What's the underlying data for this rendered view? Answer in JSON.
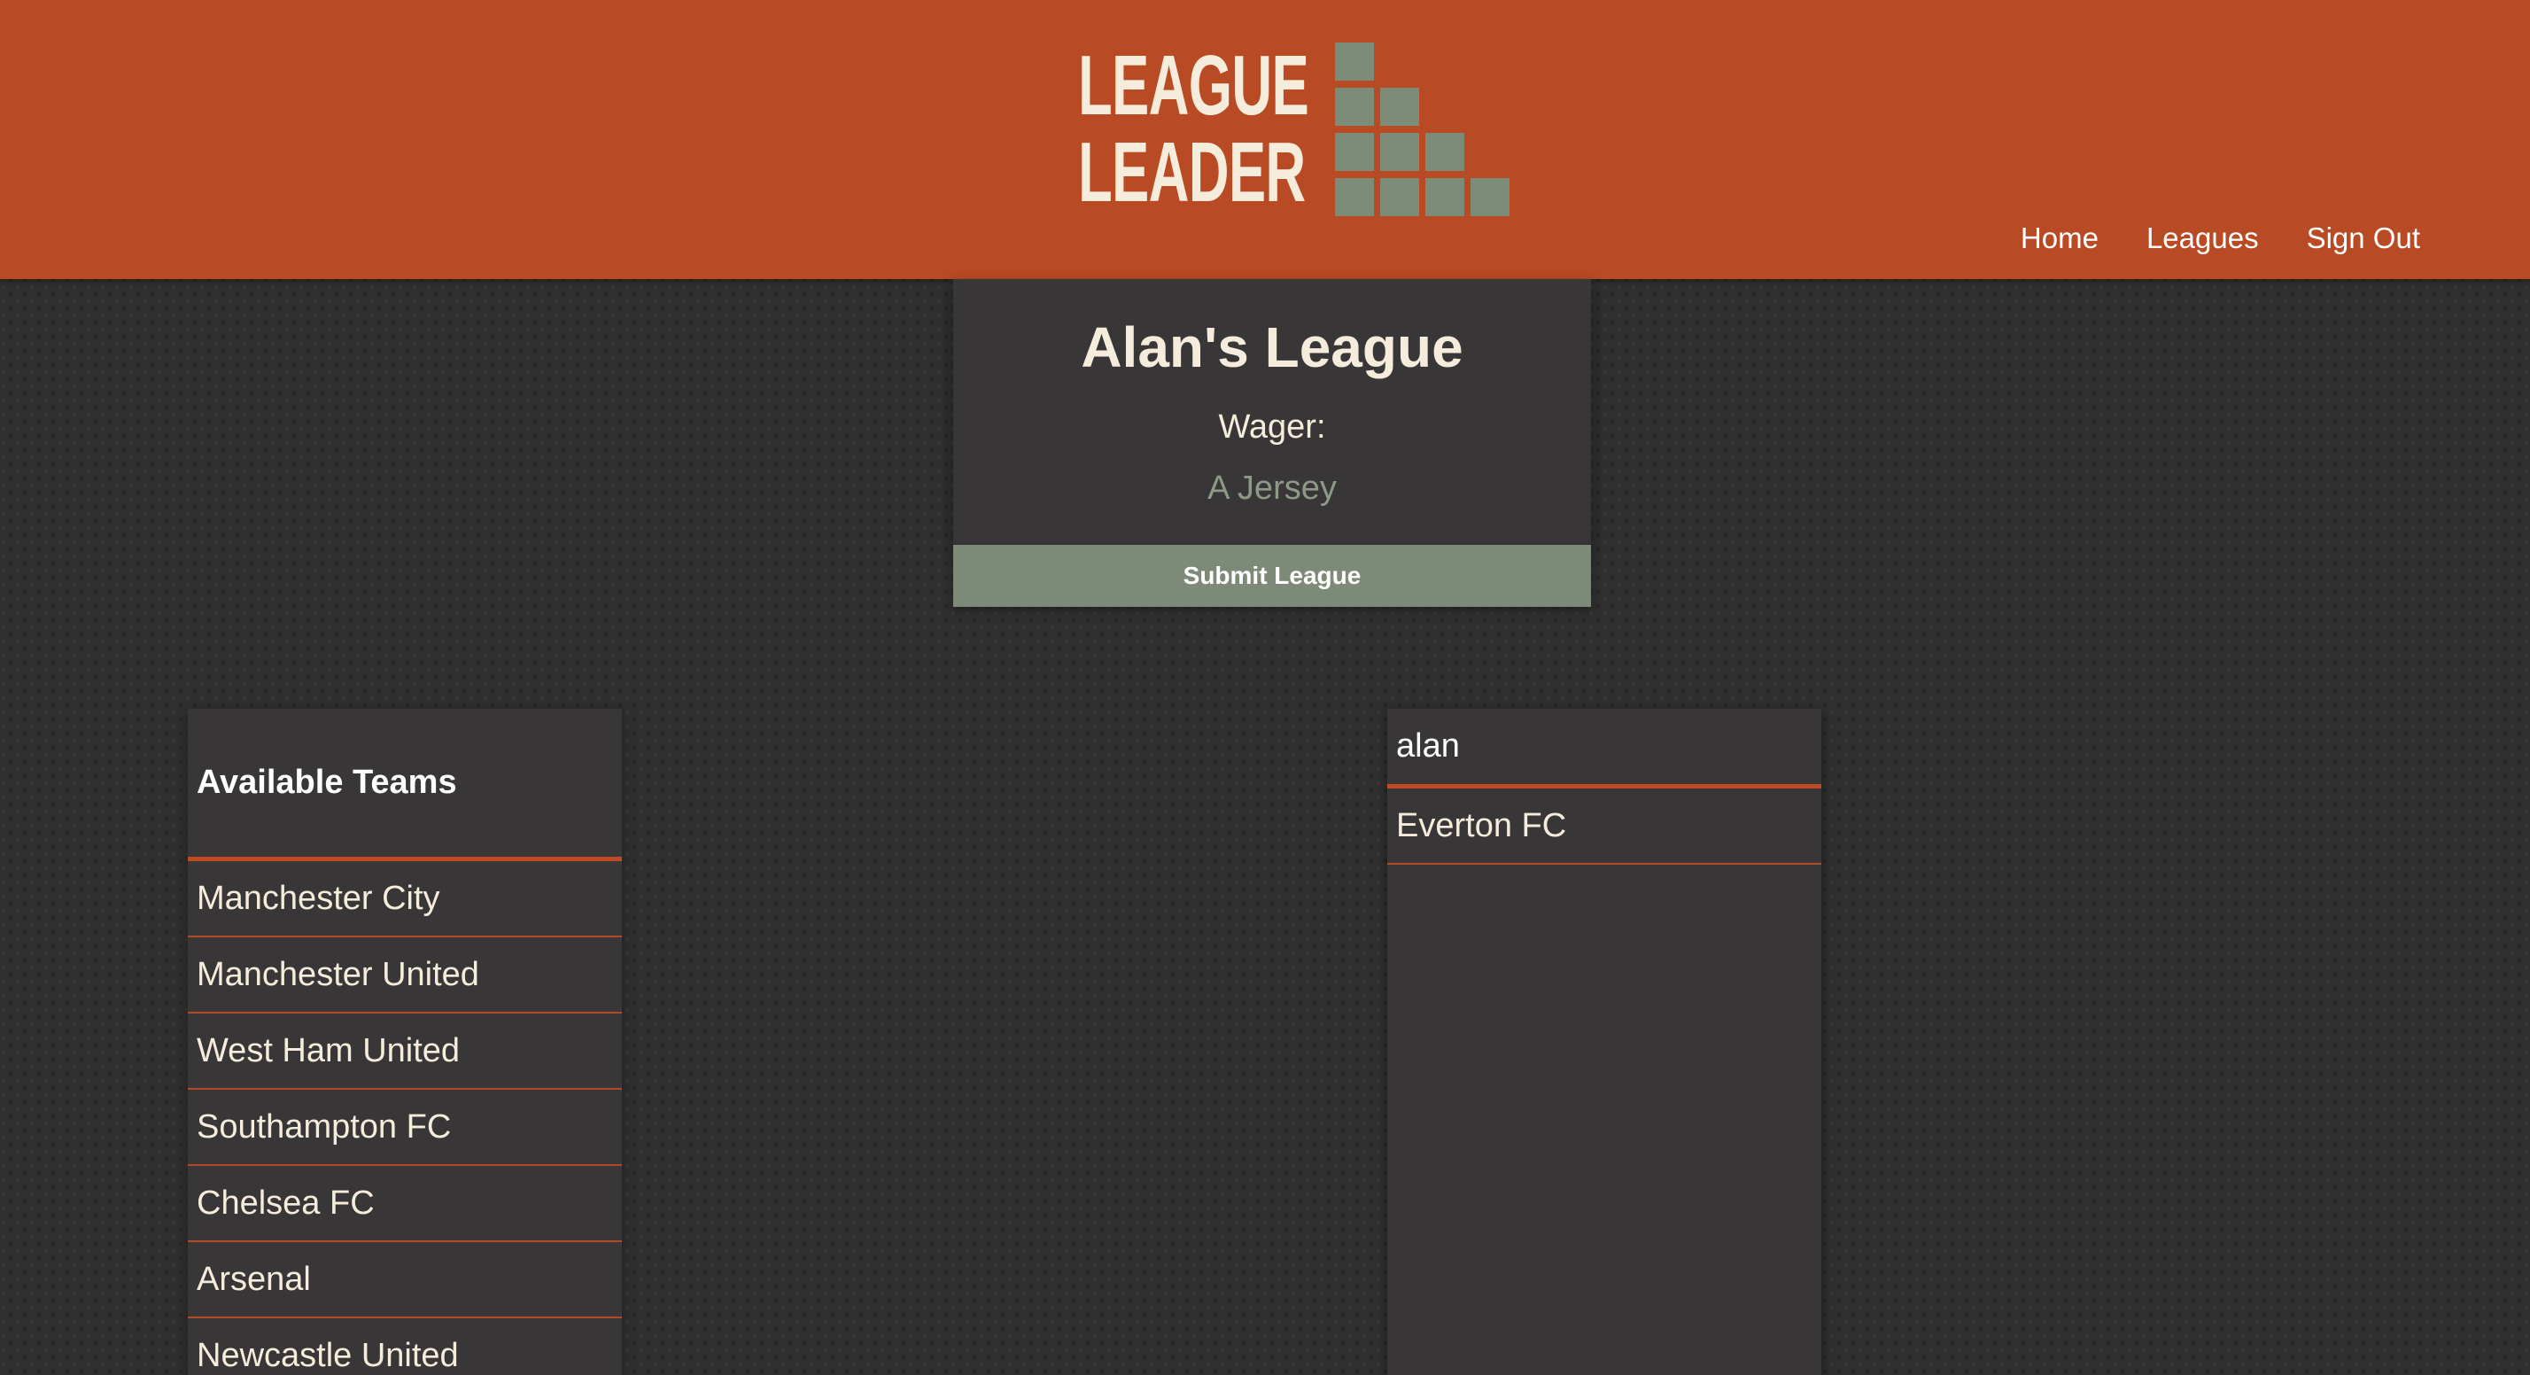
{
  "header": {
    "logo": {
      "line1": "LEAGUE",
      "line2": "LEADER"
    },
    "nav": [
      "Home",
      "Leagues",
      "Sign Out"
    ]
  },
  "colors": {
    "header_bg": "#b84a24",
    "accent": "#c04a22",
    "panel_bg": "#383636",
    "button_bg": "#7d8a78",
    "logo_block": "#7d8c79"
  },
  "league": {
    "title": "Alan's League",
    "wager_label": "Wager:",
    "wager_value": "A Jersey",
    "submit_label": "Submit League"
  },
  "available_teams": {
    "title": "Available Teams",
    "teams": [
      "Manchester City",
      "Manchester United",
      "West Ham United",
      "Southampton FC",
      "Chelsea FC",
      "Arsenal",
      "Newcastle United"
    ]
  },
  "player": {
    "name": "alan",
    "teams": [
      "Everton FC"
    ]
  }
}
